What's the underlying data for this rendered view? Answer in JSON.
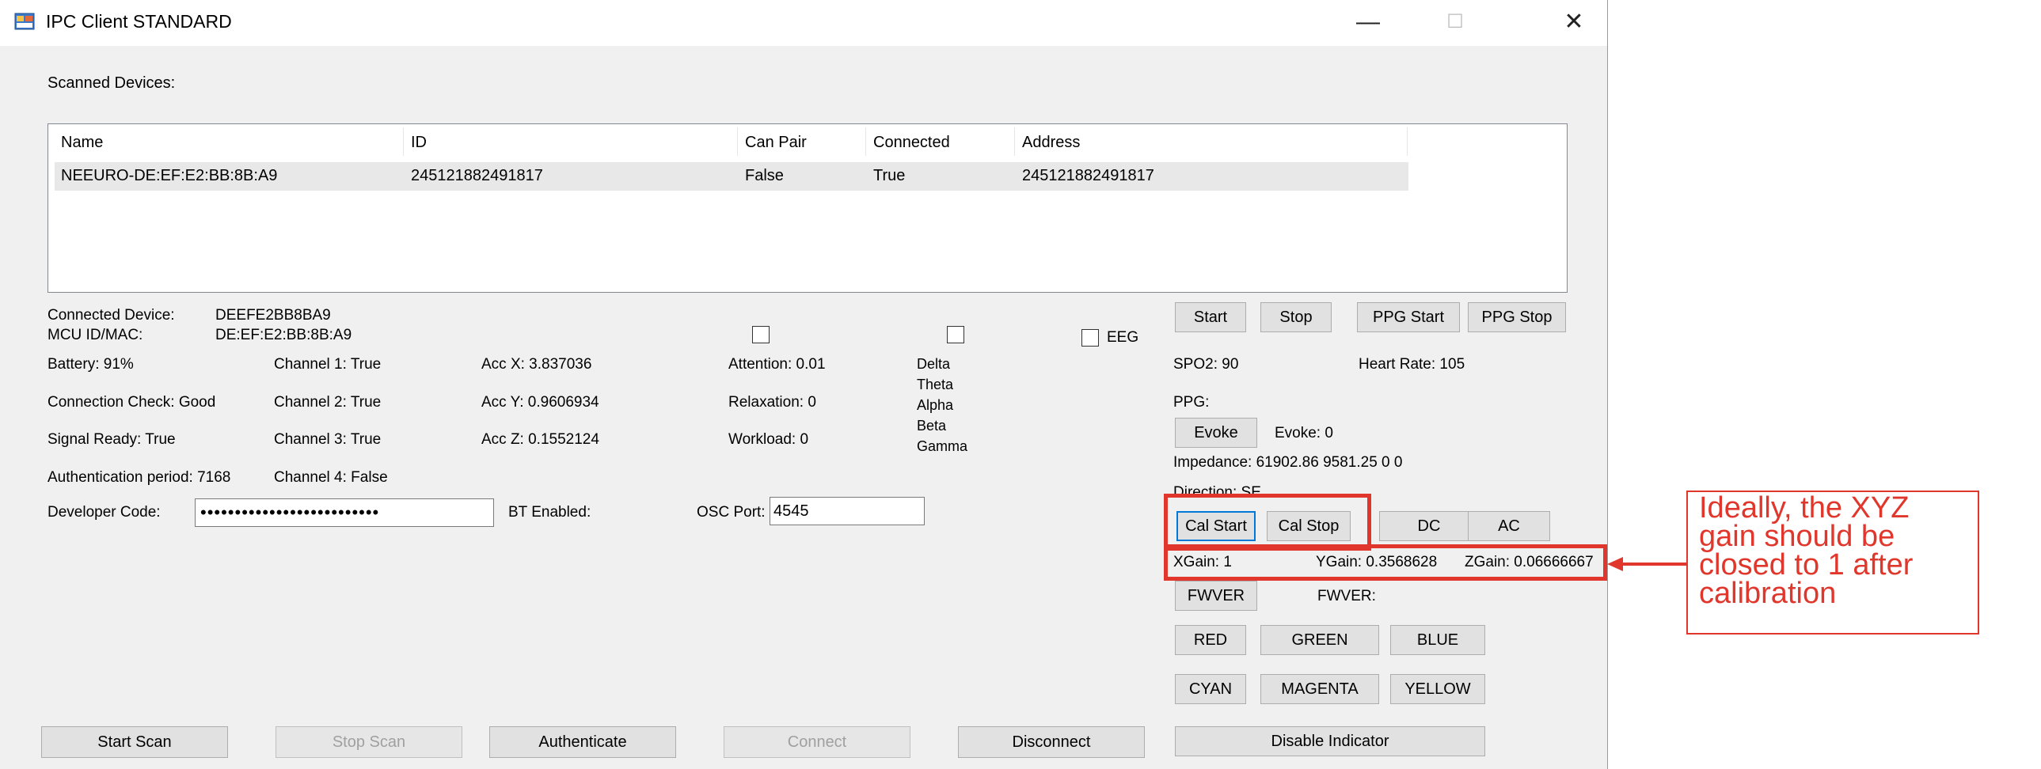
{
  "window": {
    "title": "IPC Client STANDARD",
    "minimize": "—",
    "maximize": "☐",
    "close": "✕"
  },
  "scanned": {
    "label": "Scanned Devices:",
    "columns": [
      "Name",
      "ID",
      "Can Pair",
      "Connected",
      "Address"
    ],
    "rows": [
      [
        "NEEURO-DE:EF:E2:BB:8B:A9",
        "245121882491817",
        "False",
        "True",
        "245121882491817"
      ]
    ]
  },
  "device": {
    "connected_label": "Connected Device:",
    "connected_value": "DEEFE2BB8BA9",
    "mac_label": "MCU ID/MAC:",
    "mac_value": "DE:EF:E2:BB:8B:A9",
    "battery": "Battery: 91%",
    "connection_check": "Connection Check: Good",
    "signal_ready": "Signal Ready: True",
    "auth_period": "Authentication period: 7168",
    "developer_code_label": "Developer Code:",
    "developer_code_value": "••••••••••••••••••••••••••",
    "bt_enabled": "BT Enabled:",
    "osc_port_label": "OSC Port:",
    "osc_port_value": "4545"
  },
  "channels": [
    "Channel 1: True",
    "Channel 2: True",
    "Channel 3: True",
    "Channel 4: False"
  ],
  "acc": [
    "Acc X: 3.837036",
    "Acc Y: 0.9606934",
    "Acc Z: 0.1552124"
  ],
  "mental": [
    "Attention: 0.01",
    "Relaxation: 0",
    "Workload: 0"
  ],
  "bands": [
    "Delta",
    "Theta",
    "Alpha",
    "Beta",
    "Gamma"
  ],
  "eeg_label": "EEG",
  "right": {
    "start": "Start",
    "stop": "Stop",
    "ppg_start": "PPG Start",
    "ppg_stop": "PPG Stop",
    "spo2": "SPO2: 90",
    "heart_rate": "Heart Rate: 105",
    "ppg": "PPG:",
    "evoke_btn": "Evoke",
    "evoke_value": "Evoke: 0",
    "impedance": "Impedance: 61902.86 9581.25 0 0",
    "direction": "Direction: SE",
    "cal_start": "Cal Start",
    "cal_stop": "Cal Stop",
    "dc": "DC",
    "ac": "AC",
    "xgain": "XGain: 1",
    "ygain": "YGain: 0.3568628",
    "zgain": "ZGain: 0.06666667",
    "fwver_btn": "FWVER",
    "fwver_value": "FWVER:",
    "red": "RED",
    "green": "GREEN",
    "blue": "BLUE",
    "cyan": "CYAN",
    "magenta": "MAGENTA",
    "yellow": "YELLOW",
    "disable_indicator": "Disable Indicator"
  },
  "bottom": {
    "start_scan": "Start Scan",
    "stop_scan": "Stop Scan",
    "authenticate": "Authenticate",
    "connect": "Connect",
    "disconnect": "Disconnect"
  },
  "annotation": {
    "text": "Ideally, the XYZ\ngain should be\nclosed to 1 after\ncalibration",
    "color": "#e0362b"
  }
}
